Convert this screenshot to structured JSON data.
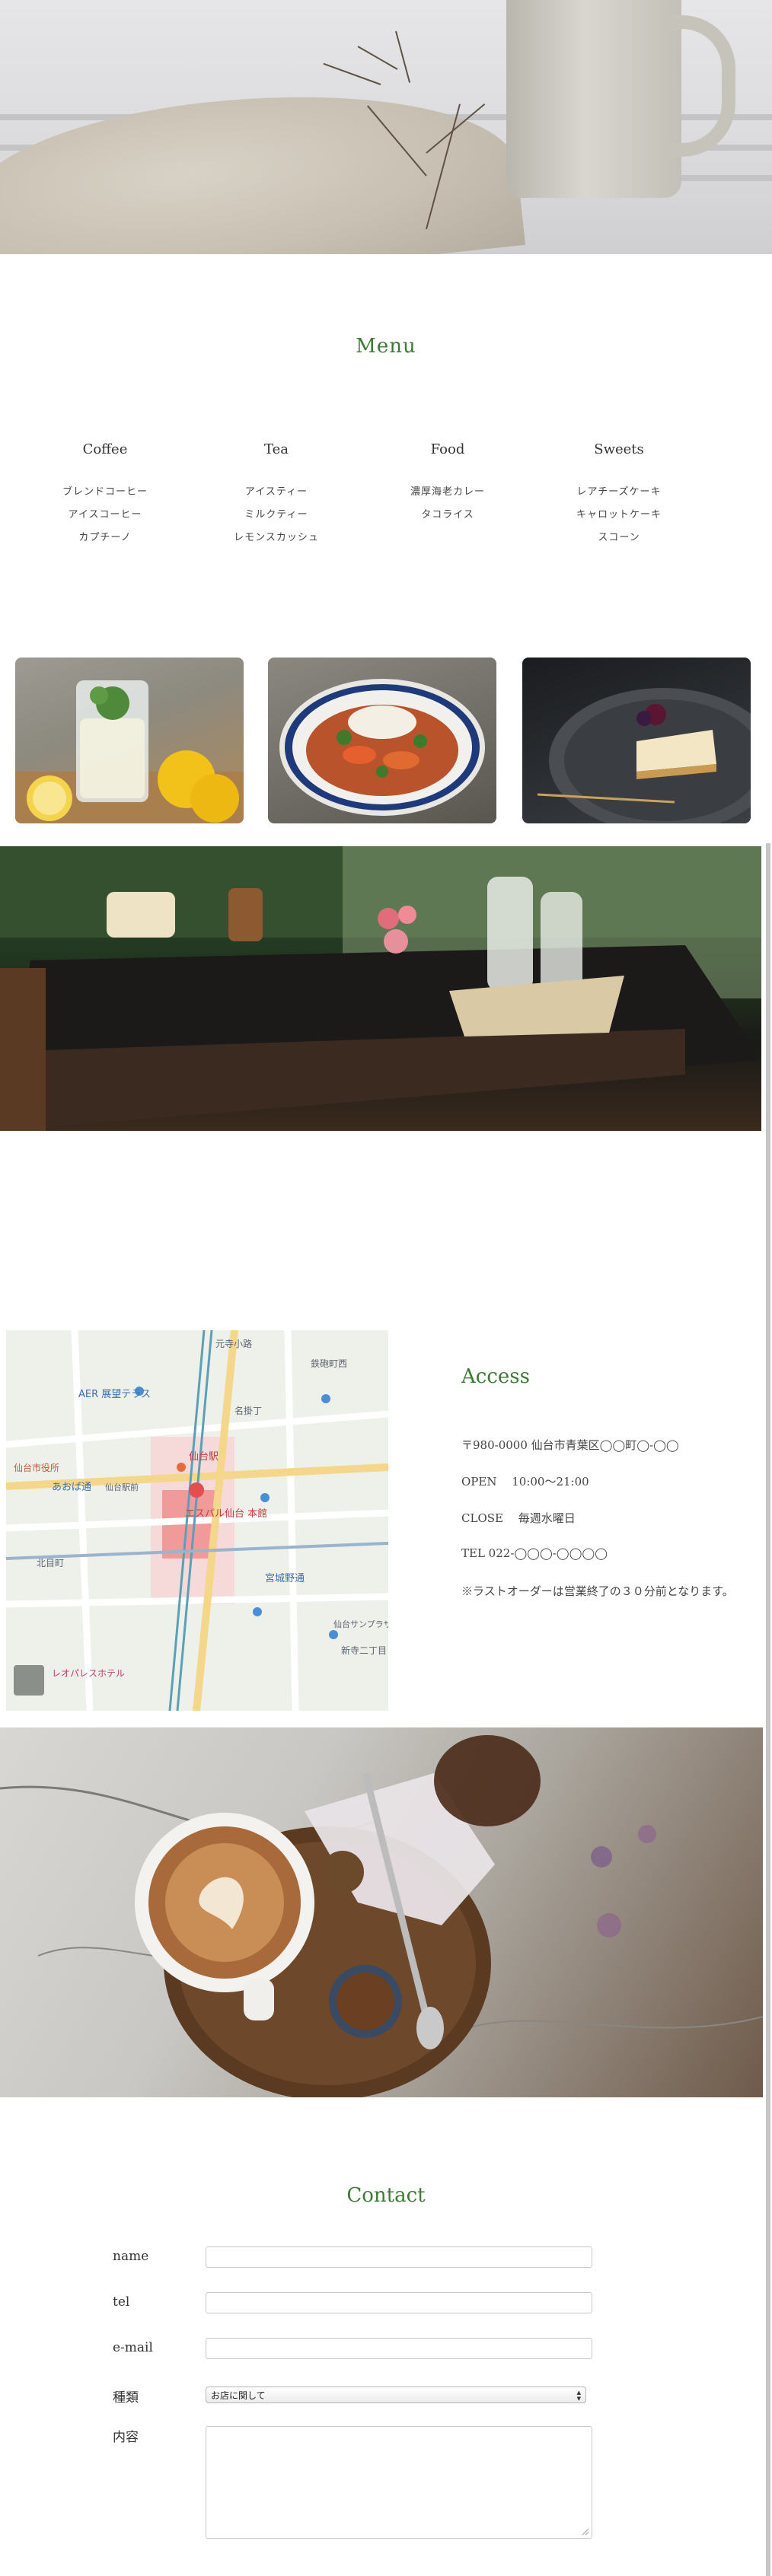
{
  "menu": {
    "title": "Menu",
    "columns": [
      {
        "category": "Coffee",
        "items": [
          "ブレンドコーヒー",
          "アイスコーヒー",
          "カプチーノ"
        ]
      },
      {
        "category": "Tea",
        "items": [
          "アイスティー",
          "ミルクティー",
          "レモンスカッシュ"
        ]
      },
      {
        "category": "Food",
        "items": [
          "濃厚海老カレー",
          "タコライス"
        ]
      },
      {
        "category": "Sweets",
        "items": [
          "レアチーズケーキ",
          "キャロットケーキ",
          "スコーン"
        ]
      }
    ]
  },
  "map": {
    "labels": [
      "元寺小路",
      "鉄砲町西",
      "AER 展望テラス",
      "名掛丁",
      "仙台駅",
      "あおば通",
      "仙台駅前",
      "エスパル仙台 本館",
      "仙台市役所",
      "宮城野通",
      "北目町",
      "新寺二丁目",
      "仙台サンプラザ",
      "レオパレスホテル"
    ]
  },
  "access": {
    "title": "Access",
    "address": "〒980-0000 仙台市青葉区◯◯町◯-◯◯",
    "open": "OPEN　 10:00〜21:00",
    "close": "CLOSE　 毎週水曜日",
    "tel": "TEL 022-◯◯◯-◯◯◯◯",
    "note": "※ラストオーダーは営業終了の３０分前となります。"
  },
  "contact": {
    "title": "Contact",
    "name_label": "name",
    "tel_label": "tel",
    "email_label": "e-mail",
    "type_label": "種類",
    "type_selected": "お店に関して",
    "content_label": "内容"
  },
  "colors": {
    "accent": "#3d7a35"
  }
}
